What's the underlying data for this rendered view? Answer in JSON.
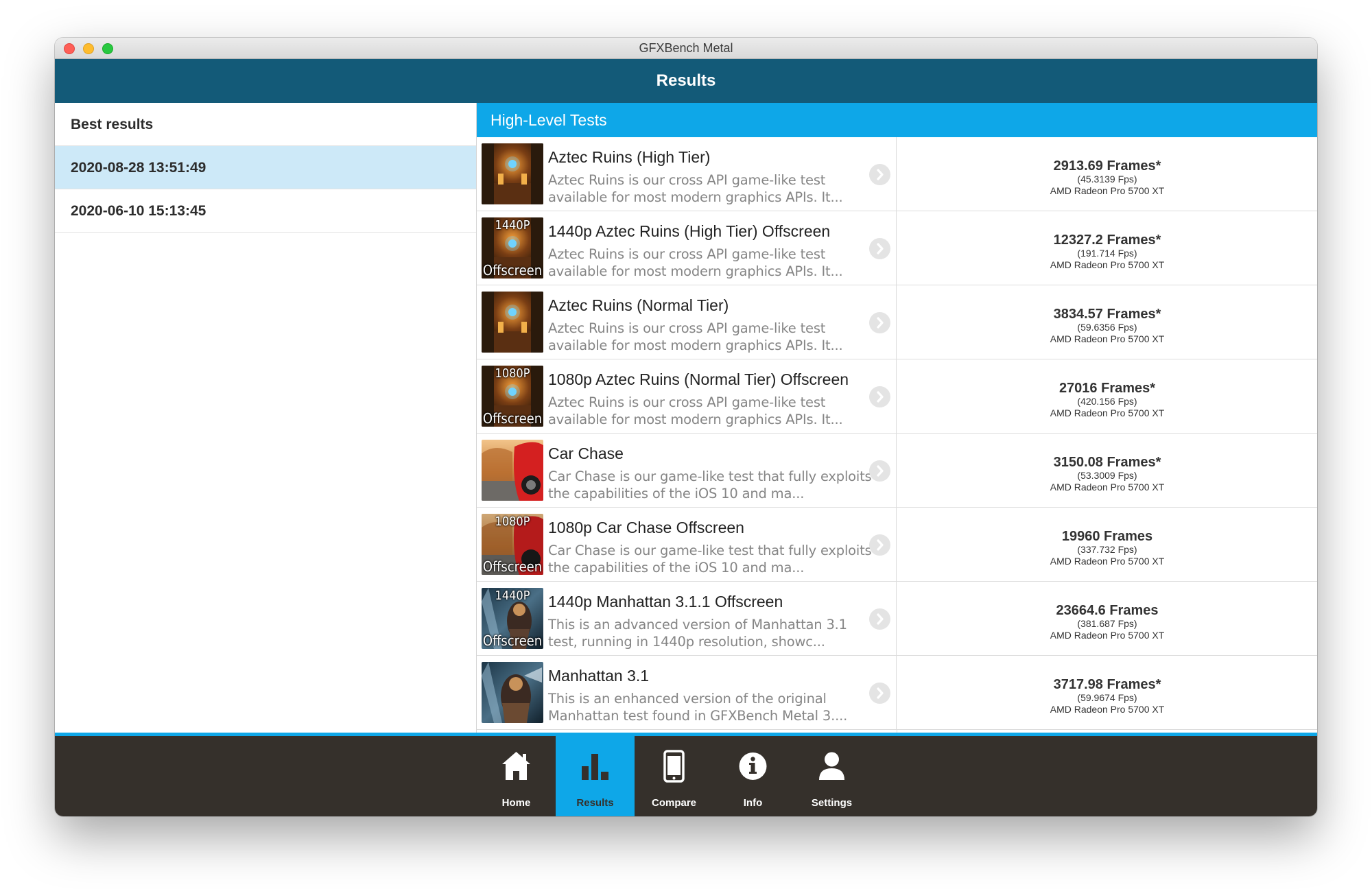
{
  "window": {
    "title": "GFXBench Metal"
  },
  "header": {
    "title": "Results"
  },
  "sidebar": {
    "header": "Best results",
    "items": [
      {
        "label": "2020-08-28 13:51:49",
        "selected": true
      },
      {
        "label": "2020-06-10 15:13:45",
        "selected": false
      }
    ]
  },
  "section": {
    "title": "High-Level Tests"
  },
  "tests": [
    {
      "name": "Aztec Ruins (High Tier)",
      "description": "Aztec Ruins is our cross API game-like test available for most modern graphics APIs. It...",
      "thumb_top": "",
      "thumb_bottom": "",
      "score": "2913.69 Frames*",
      "fps": "(45.3139 Fps)",
      "device": "AMD Radeon Pro 5700 XT"
    },
    {
      "name": "1440p Aztec Ruins (High Tier) Offscreen",
      "description": "Aztec Ruins is our cross API game-like test available for most modern graphics APIs. It...",
      "thumb_top": "1440P",
      "thumb_bottom": "Offscreen",
      "score": "12327.2 Frames*",
      "fps": "(191.714 Fps)",
      "device": "AMD Radeon Pro 5700 XT"
    },
    {
      "name": "Aztec Ruins (Normal Tier)",
      "description": "Aztec Ruins is our cross API game-like test available for most modern graphics APIs. It...",
      "thumb_top": "",
      "thumb_bottom": "",
      "score": "3834.57 Frames*",
      "fps": "(59.6356 Fps)",
      "device": "AMD Radeon Pro 5700 XT"
    },
    {
      "name": "1080p Aztec Ruins (Normal Tier) Offscreen",
      "description": "Aztec Ruins is our cross API game-like test available for most modern graphics APIs. It...",
      "thumb_top": "1080P",
      "thumb_bottom": "Offscreen",
      "score": "27016 Frames*",
      "fps": "(420.156 Fps)",
      "device": "AMD Radeon Pro 5700 XT"
    },
    {
      "name": "Car Chase",
      "description": "Car Chase is our game-like test that fully exploits the capabilities of the iOS 10 and ma...",
      "thumb_top": "",
      "thumb_bottom": "",
      "score": "3150.08 Frames*",
      "fps": "(53.3009 Fps)",
      "device": "AMD Radeon Pro 5700 XT"
    },
    {
      "name": "1080p Car Chase Offscreen",
      "description": "Car Chase is our game-like test that fully exploits the capabilities of the iOS 10 and ma...",
      "thumb_top": "1080P",
      "thumb_bottom": "Offscreen",
      "score": "19960 Frames",
      "fps": "(337.732 Fps)",
      "device": "AMD Radeon Pro 5700 XT"
    },
    {
      "name": "1440p Manhattan 3.1.1 Offscreen",
      "description": "This is an advanced version of Manhattan 3.1 test, running in 1440p resolution, showc...",
      "thumb_top": "1440P",
      "thumb_bottom": "Offscreen",
      "score": "23664.6 Frames",
      "fps": "(381.687 Fps)",
      "device": "AMD Radeon Pro 5700 XT"
    },
    {
      "name": "Manhattan 3.1",
      "description": "This is an enhanced version of the original Manhattan test found in GFXBench Metal 3....",
      "thumb_top": "",
      "thumb_bottom": "",
      "score": "3717.98 Frames*",
      "fps": "(59.9674 Fps)",
      "device": "AMD Radeon Pro 5700 XT"
    }
  ],
  "nav": {
    "items": [
      {
        "label": "Home",
        "icon": "home-icon"
      },
      {
        "label": "Results",
        "icon": "bar-chart-icon",
        "active": true
      },
      {
        "label": "Compare",
        "icon": "phone-icon"
      },
      {
        "label": "Info",
        "icon": "info-icon"
      },
      {
        "label": "Settings",
        "icon": "user-icon"
      }
    ]
  },
  "colors": {
    "header": "#135a78",
    "accent": "#0ea7e8",
    "selected_row": "#cde9f8",
    "bottom_bar": "#35302b"
  }
}
